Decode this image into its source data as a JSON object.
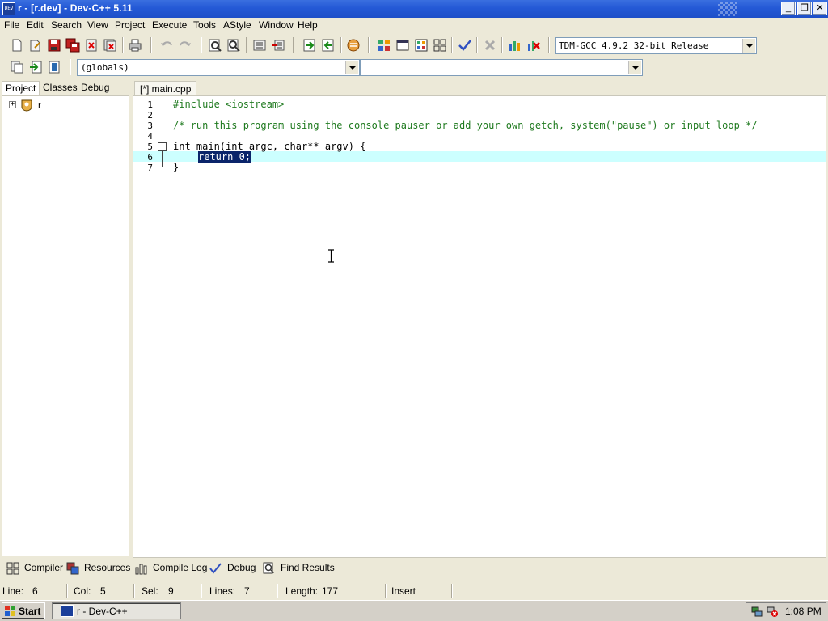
{
  "window": {
    "title": "r - [r.dev] - Dev-C++ 5.11",
    "app_icon_text": "DEV",
    "controls": {
      "minimize": "_",
      "restore": "❐",
      "close": "✕"
    }
  },
  "menu": [
    "File",
    "Edit",
    "Search",
    "View",
    "Project",
    "Execute",
    "Tools",
    "AStyle",
    "Window",
    "Help"
  ],
  "toolbar": {
    "compiler_select": "TDM-GCC 4.9.2 32-bit Release",
    "scope_select": "(globals)",
    "member_select": ""
  },
  "left_panel": {
    "tabs": [
      "Project",
      "Classes",
      "Debug"
    ],
    "tree_root": "r",
    "expander": "+"
  },
  "editor": {
    "tab_label": "[*] main.cpp",
    "line_numbers": [
      "1",
      "2",
      "3",
      "4",
      "5",
      "6",
      "7"
    ],
    "lines": {
      "l1": "#include <iostream>",
      "l3": "/* run this program using the console pauser or add your own getch, system(\"pause\") or input loop */",
      "l5_int": "int",
      "l5_rest": " main(int argc, char** argv) {",
      "l6_selected": "return 0;",
      "l7": "}"
    },
    "fold_minus": "−",
    "current_line": 6
  },
  "bottom_tabs": [
    "Compiler",
    "Resources",
    "Compile Log",
    "Debug",
    "Find Results"
  ],
  "status": {
    "line_label": "Line:",
    "line_value": "6",
    "col_label": "Col:",
    "col_value": "5",
    "sel_label": "Sel:",
    "sel_value": "9",
    "lines_label": "Lines:",
    "lines_value": "7",
    "length_label": "Length:",
    "length_value": "177",
    "mode": "Insert"
  },
  "taskbar": {
    "start_label": "Start",
    "task_label": "r - Dev-C++",
    "clock": "1:08 PM"
  },
  "colors": {
    "titlebar": "#2459d6",
    "selection": "#0a246a",
    "current_line_highlight": "#ccffff",
    "comment": "#1f7a1f"
  }
}
